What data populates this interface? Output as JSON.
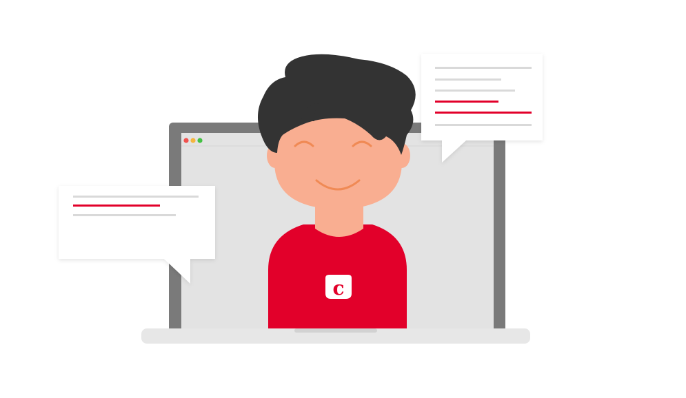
{
  "illustration": {
    "badge_letter": "c",
    "colors": {
      "background": "#ffffff",
      "laptop_frame": "#7a7a7a",
      "laptop_screen": "#e3e3e3",
      "laptop_base": "#e7e7e7",
      "laptop_notch": "#d2d2d2",
      "window_dot_red": "#f0524f",
      "window_dot_yellow": "#f4b63f",
      "window_dot_green": "#44c144",
      "hair": "#333333",
      "skin": "#f9ae91",
      "smile": "#f08a55",
      "shirt": "#e2002a",
      "bubble": "#ffffff",
      "bubble_line_gray": "#d9d9d9",
      "bubble_line_red": "#e2002a"
    },
    "icons": {
      "laptop": "laptop-icon",
      "person": "person-avatar",
      "brand_badge": "brand-badge-icon",
      "chat_bubble": "chat-bubble-icon"
    }
  }
}
